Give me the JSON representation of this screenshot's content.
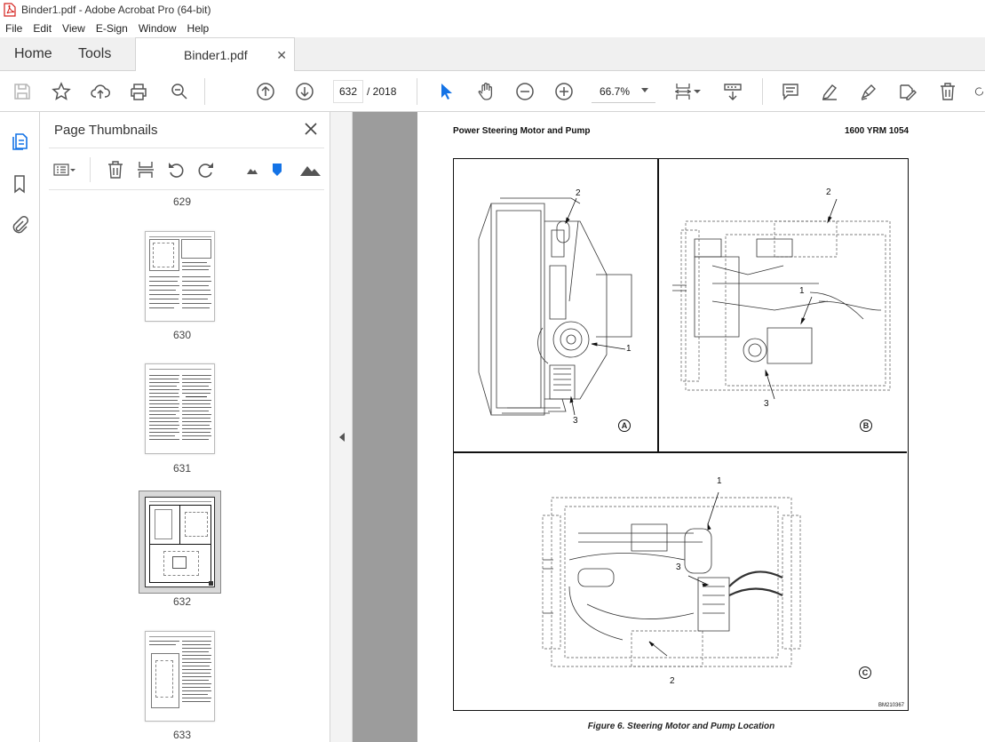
{
  "window": {
    "title": "Binder1.pdf - Adobe Acrobat Pro (64-bit)"
  },
  "menu": [
    "File",
    "Edit",
    "View",
    "E-Sign",
    "Window",
    "Help"
  ],
  "tabs": {
    "home": "Home",
    "tools": "Tools",
    "document": "Binder1.pdf"
  },
  "toolbar": {
    "page_current": "632",
    "page_total": "/ 2018",
    "zoom": "66.7%"
  },
  "panel": {
    "title": "Page Thumbnails",
    "thumbnails": [
      {
        "label": "629"
      },
      {
        "label": "630"
      },
      {
        "label": "631"
      },
      {
        "label": "632",
        "selected": true
      },
      {
        "label": "633"
      }
    ]
  },
  "document": {
    "header_left": "Power Steering Motor and Pump",
    "header_right": "1600 YRM 1054",
    "figure": {
      "panel_a": {
        "letter": "A",
        "callouts": [
          "2",
          "1",
          "3"
        ]
      },
      "panel_b": {
        "letter": "B",
        "callouts": [
          "2",
          "1",
          "3"
        ]
      },
      "panel_c": {
        "letter": "C",
        "callouts": [
          "1",
          "3",
          "2"
        ]
      },
      "ref": "BM210367",
      "caption": "Figure 6.  Steering Motor and Pump Location"
    }
  },
  "colors": {
    "accent": "#1473e6",
    "acrobat_red": "#d4201c",
    "viewer_bg": "#9c9c9c"
  }
}
